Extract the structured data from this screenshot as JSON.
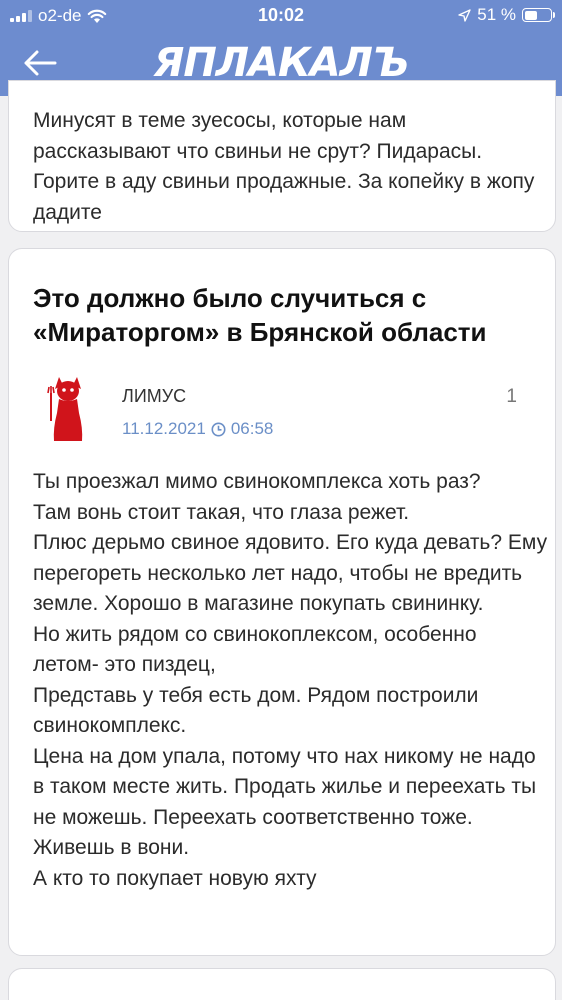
{
  "status_bar": {
    "carrier": "o2-de",
    "time": "10:02",
    "battery": "51 %",
    "battery_level": 0.51
  },
  "header": {
    "logo": "ЯПЛАКАЛЪ",
    "back_icon": "back-arrow-icon"
  },
  "previous_comment": {
    "text": "Минусят в теме зуесосы, которые нам рассказывают что свиньи не срут? Пидарасы. Горите в аду свиньи продажные. За копейку в жопу дадите"
  },
  "post": {
    "title": "Это должно было случиться с «Мираторгом» в Брянской области",
    "author": "ЛИМУС",
    "date": "11.12.2021",
    "time": "06:58",
    "rating": "1",
    "lines": [
      "Ты проезжал мимо свинокомплекса хоть раз?",
      "Там вонь стоит такая, что глаза режет.",
      "Плюс дерьмо свиное ядовито. Его куда девать? Ему перегореть несколько лет надо, чтобы не вредить земле. Хорошо в магазине покупать свининку.",
      "Но жить рядом со свинокоплексом, особенно летом- это пиздец,",
      "Представь у тебя есть дом. Рядом построили свинокомплекс.",
      "Цена на дом упала, потому что нах никому не надо в таком месте жить. Продать жилье и переехать ты не можешь. Переехать соответственно тоже. Живешь в вони.",
      "А кто то покупает новую яхту"
    ]
  },
  "colors": {
    "header_blue": "#6d8ccf",
    "meta_blue": "#6b8fc7",
    "avatar_red": "#d0141b"
  }
}
